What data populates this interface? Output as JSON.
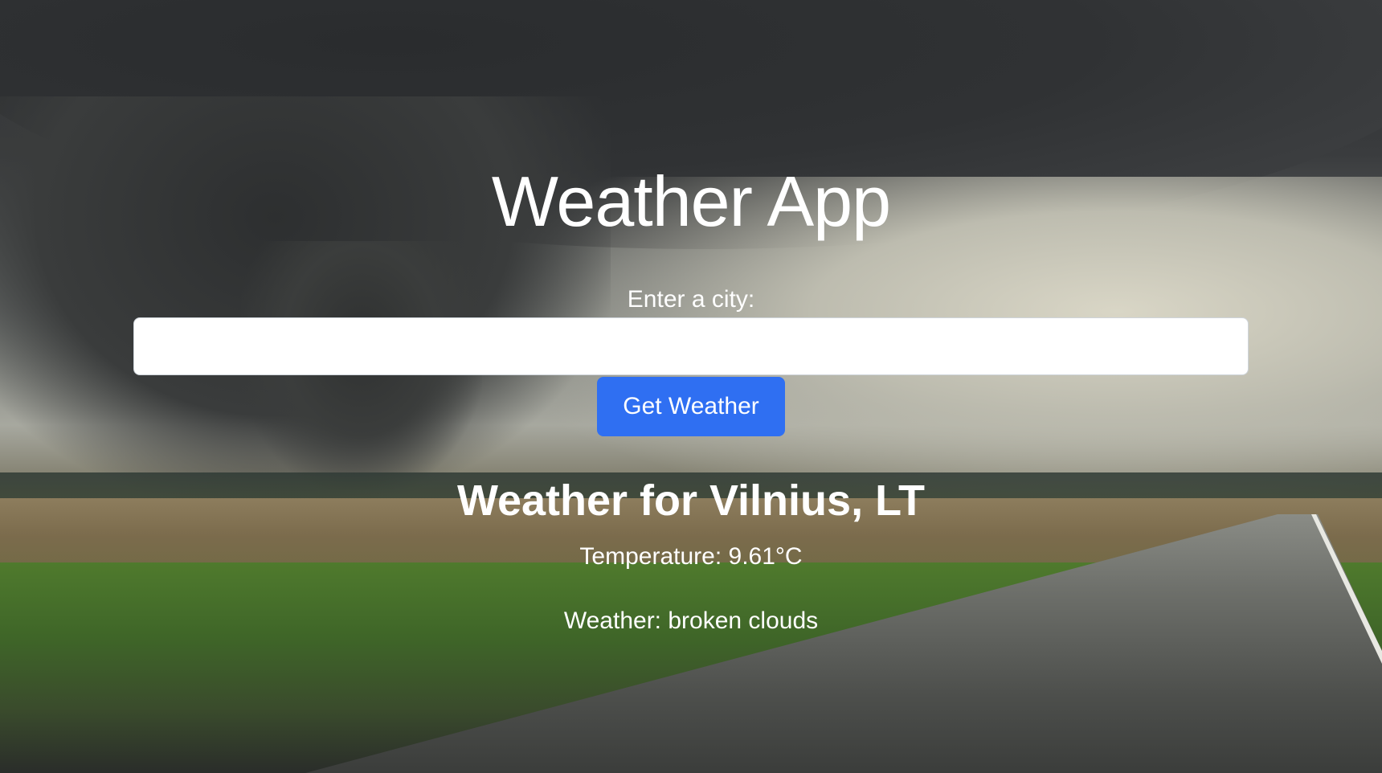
{
  "app": {
    "title": "Weather App"
  },
  "search": {
    "label": "Enter a city:",
    "value": "",
    "button_label": "Get Weather"
  },
  "result": {
    "heading": "Weather for Vilnius, LT",
    "temperature": "Temperature: 9.61°C",
    "description": "Weather: broken clouds"
  },
  "colors": {
    "button": "#2f6ff2",
    "text": "#ffffff"
  }
}
